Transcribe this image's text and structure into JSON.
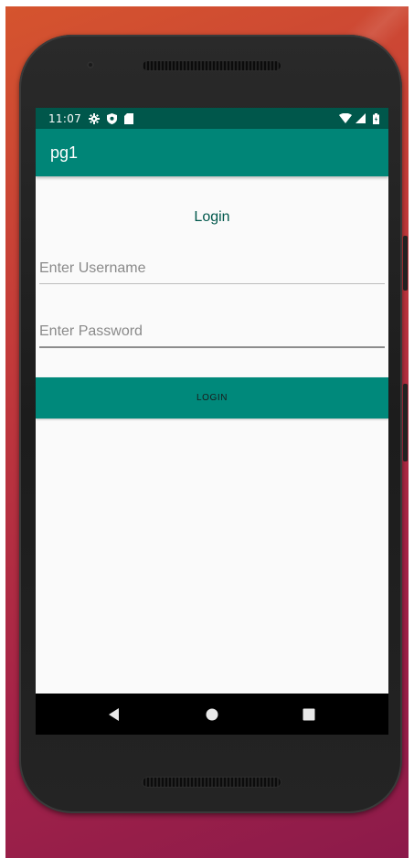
{
  "status_bar": {
    "time": "11:07",
    "icons_left": [
      "settings-gear-icon",
      "shield-icon",
      "sd-card-icon"
    ],
    "icons_right": [
      "wifi-icon",
      "cell-signal-icon",
      "battery-icon"
    ]
  },
  "app_bar": {
    "title": "pg1"
  },
  "login_form": {
    "title": "Login",
    "username_placeholder": "Enter Username",
    "password_placeholder": "Enter Password",
    "submit_label": "LOGIN"
  },
  "nav_bar": {
    "buttons": [
      "back-icon",
      "home-icon",
      "recents-icon"
    ]
  },
  "colors": {
    "status_bar": "#00574b",
    "app_bar": "#008577",
    "accent": "#00897b",
    "title_text": "#00574b",
    "screen_bg": "#fafafa"
  }
}
